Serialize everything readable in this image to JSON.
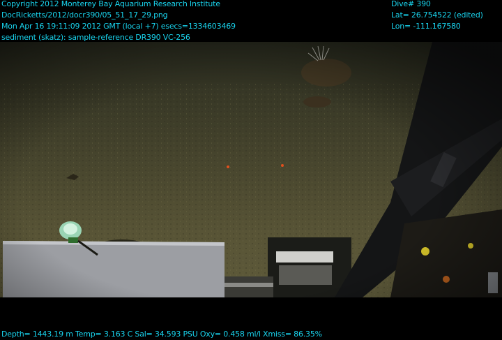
{
  "overlay": {
    "top_left": [
      "Copyright 2012 Monterey Bay Aquarium Research Institute",
      "DocRicketts/2012/docr390/05_51_17_29.png",
      "Mon Apr 16 19:11:09 2012 GMT (local +7)  esecs=1334603469",
      "sediment (skatz): sample-reference DR390 VC-256"
    ],
    "top_right": [
      "Dive# 390",
      "Lat= 26.754522 (edited)",
      "Lon= -111.167580"
    ],
    "bottom": "Depth= 1443.19 m  Temp= 3.163 C  Sal= 34.593 PSU  Oxy= 0.458 ml/l  Xmiss= 86.35%"
  },
  "colors": {
    "overlay_text": "#19d4ee",
    "background": "#000000",
    "seafloor": "#5a5637",
    "water": "#2e3022",
    "panel": "#9c9ea3"
  }
}
